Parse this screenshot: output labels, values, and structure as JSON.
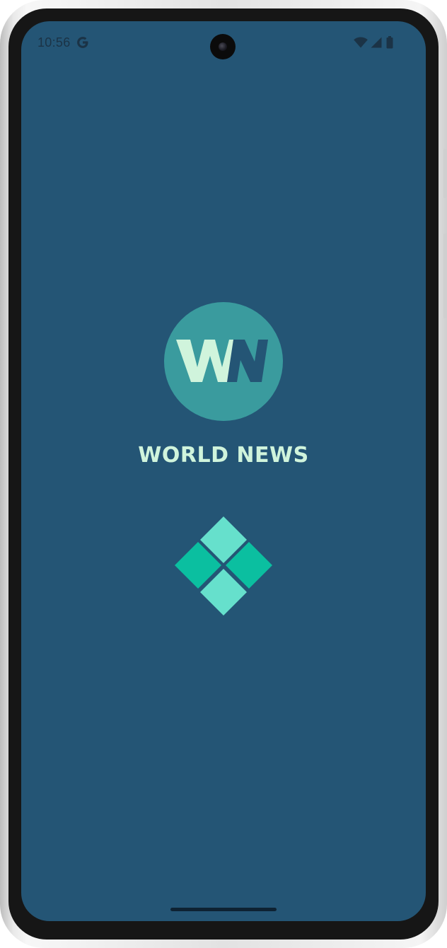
{
  "status_bar": {
    "time": "10:56",
    "google_icon": "google-g-icon",
    "wifi_icon": "wifi-icon",
    "signal_icon": "cellular-signal-icon",
    "battery_icon": "battery-icon"
  },
  "splash": {
    "logo_letters": "WN",
    "app_title": "WORLD NEWS",
    "loader_icon": "loading-diamond-icon"
  },
  "colors": {
    "background": "#245575",
    "logo_circle": "#3a9b9e",
    "logo_w": "#d0f4dc",
    "logo_n": "#245575",
    "title": "#d0f4dc",
    "loader_light": "#66e0cc",
    "loader_dark": "#0bbfa0"
  }
}
